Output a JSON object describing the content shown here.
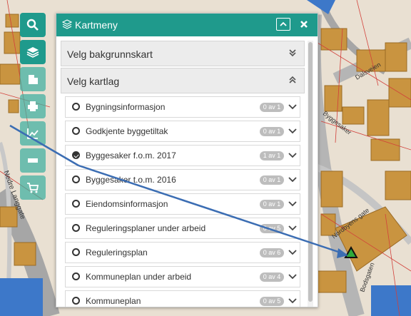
{
  "panel": {
    "title": "Kartmeny",
    "icons": {
      "menu": "layers-icon",
      "collapse": "chevron-up-icon",
      "close": "close-icon"
    }
  },
  "toolbar": {
    "tools": [
      {
        "name": "search-icon",
        "state": "active"
      },
      {
        "name": "layers-icon",
        "state": "active"
      },
      {
        "name": "buildings-icon",
        "state": "faded"
      },
      {
        "name": "print-icon",
        "state": "faded"
      },
      {
        "name": "chart-icon",
        "state": "faded"
      },
      {
        "name": "measure-icon",
        "state": "faded"
      },
      {
        "name": "cart-icon",
        "state": "faded"
      }
    ]
  },
  "sections": [
    {
      "label": "Velg bakgrunnskart",
      "icon": "chevron-double-down-icon"
    },
    {
      "label": "Velg kartlag",
      "icon": "chevron-double-up-icon"
    }
  ],
  "layers": [
    {
      "label": "Bygningsinformasjon",
      "badge": "0 av 1",
      "checked": false
    },
    {
      "label": "Godkjente byggetiltak",
      "badge": "0 av 1",
      "checked": false
    },
    {
      "label": "Byggesaker f.o.m. 2017",
      "badge": "1 av 1",
      "checked": true
    },
    {
      "label": "Byggesaker t.o.m. 2016",
      "badge": "0 av 1",
      "checked": false
    },
    {
      "label": "Eiendomsinformasjon",
      "badge": "0 av 1",
      "checked": false
    },
    {
      "label": "Reguleringsplaner under arbeid",
      "badge": "0 av 5",
      "checked": false
    },
    {
      "label": "Reguleringsplan",
      "badge": "0 av 6",
      "checked": false
    },
    {
      "label": "Kommuneplan under arbeid",
      "badge": "0 av 4",
      "checked": false
    },
    {
      "label": "Kommuneplan",
      "badge": "0 av 5",
      "checked": false
    }
  ],
  "map": {
    "street_labels": [
      "Nedre Langgate",
      "Byggesaker",
      "Dalsveien",
      "Nordbyens gate",
      "Bodsgaten"
    ],
    "colors": {
      "building": "#c99440",
      "building_dark": "#9b6b25",
      "road": "#a6a6a6",
      "water": "#3d78c9",
      "ground": "#e9e0d2",
      "lines": "#d2403a"
    },
    "marker_icon": "triangle-marker-icon"
  }
}
